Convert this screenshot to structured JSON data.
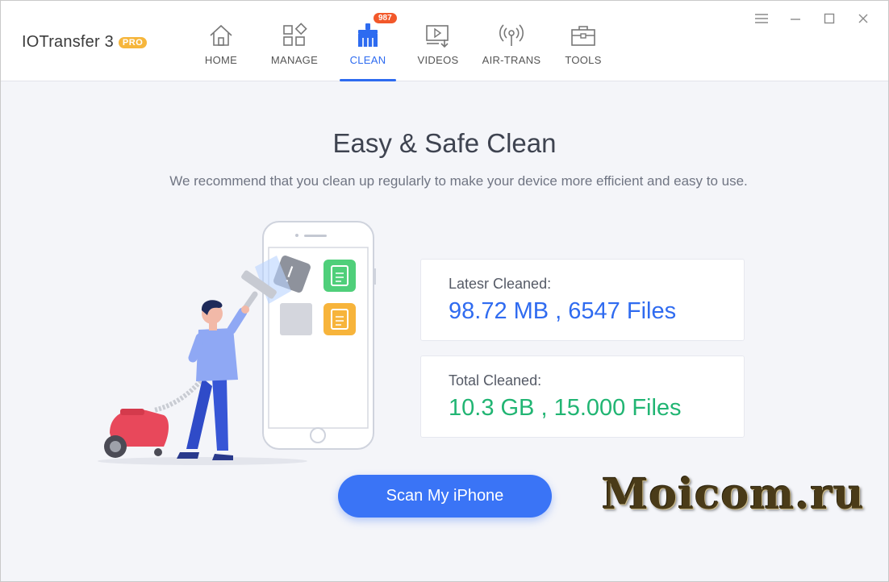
{
  "app": {
    "title": "IOTransfer 3",
    "badge": "PRO"
  },
  "nav": {
    "tabs": [
      {
        "label": "HOME",
        "icon": "home-icon"
      },
      {
        "label": "MANAGE",
        "icon": "manage-grid-icon"
      },
      {
        "label": "CLEAN",
        "icon": "broom-icon",
        "badge": "987",
        "active": true
      },
      {
        "label": "VIDEOS",
        "icon": "video-download-icon"
      },
      {
        "label": "AIR-TRANS",
        "icon": "wireless-icon"
      },
      {
        "label": "TOOLS",
        "icon": "toolbox-icon"
      }
    ]
  },
  "window_controls": [
    "menu-icon",
    "minimize-icon",
    "maximize-icon",
    "close-icon"
  ],
  "main": {
    "title": "Easy & Safe Clean",
    "subtitle": "We recommend that you clean up regularly to make your device more efficient and easy to use.",
    "stats": {
      "latest": {
        "label": "Latesr Cleaned:",
        "value": "98.72 MB , 6547 Files"
      },
      "total": {
        "label": "Total Cleaned:",
        "value": "10.3 GB , 15.000 Files"
      }
    },
    "scan_button": "Scan My iPhone"
  },
  "watermark": "Moicom.ru",
  "colors": {
    "accent": "#2d6bf0",
    "button": "#3a74f6",
    "latest_value": "#2f6bf0",
    "total_value": "#21b573",
    "badge": "#f2582a",
    "pro": "#f6b63c"
  }
}
